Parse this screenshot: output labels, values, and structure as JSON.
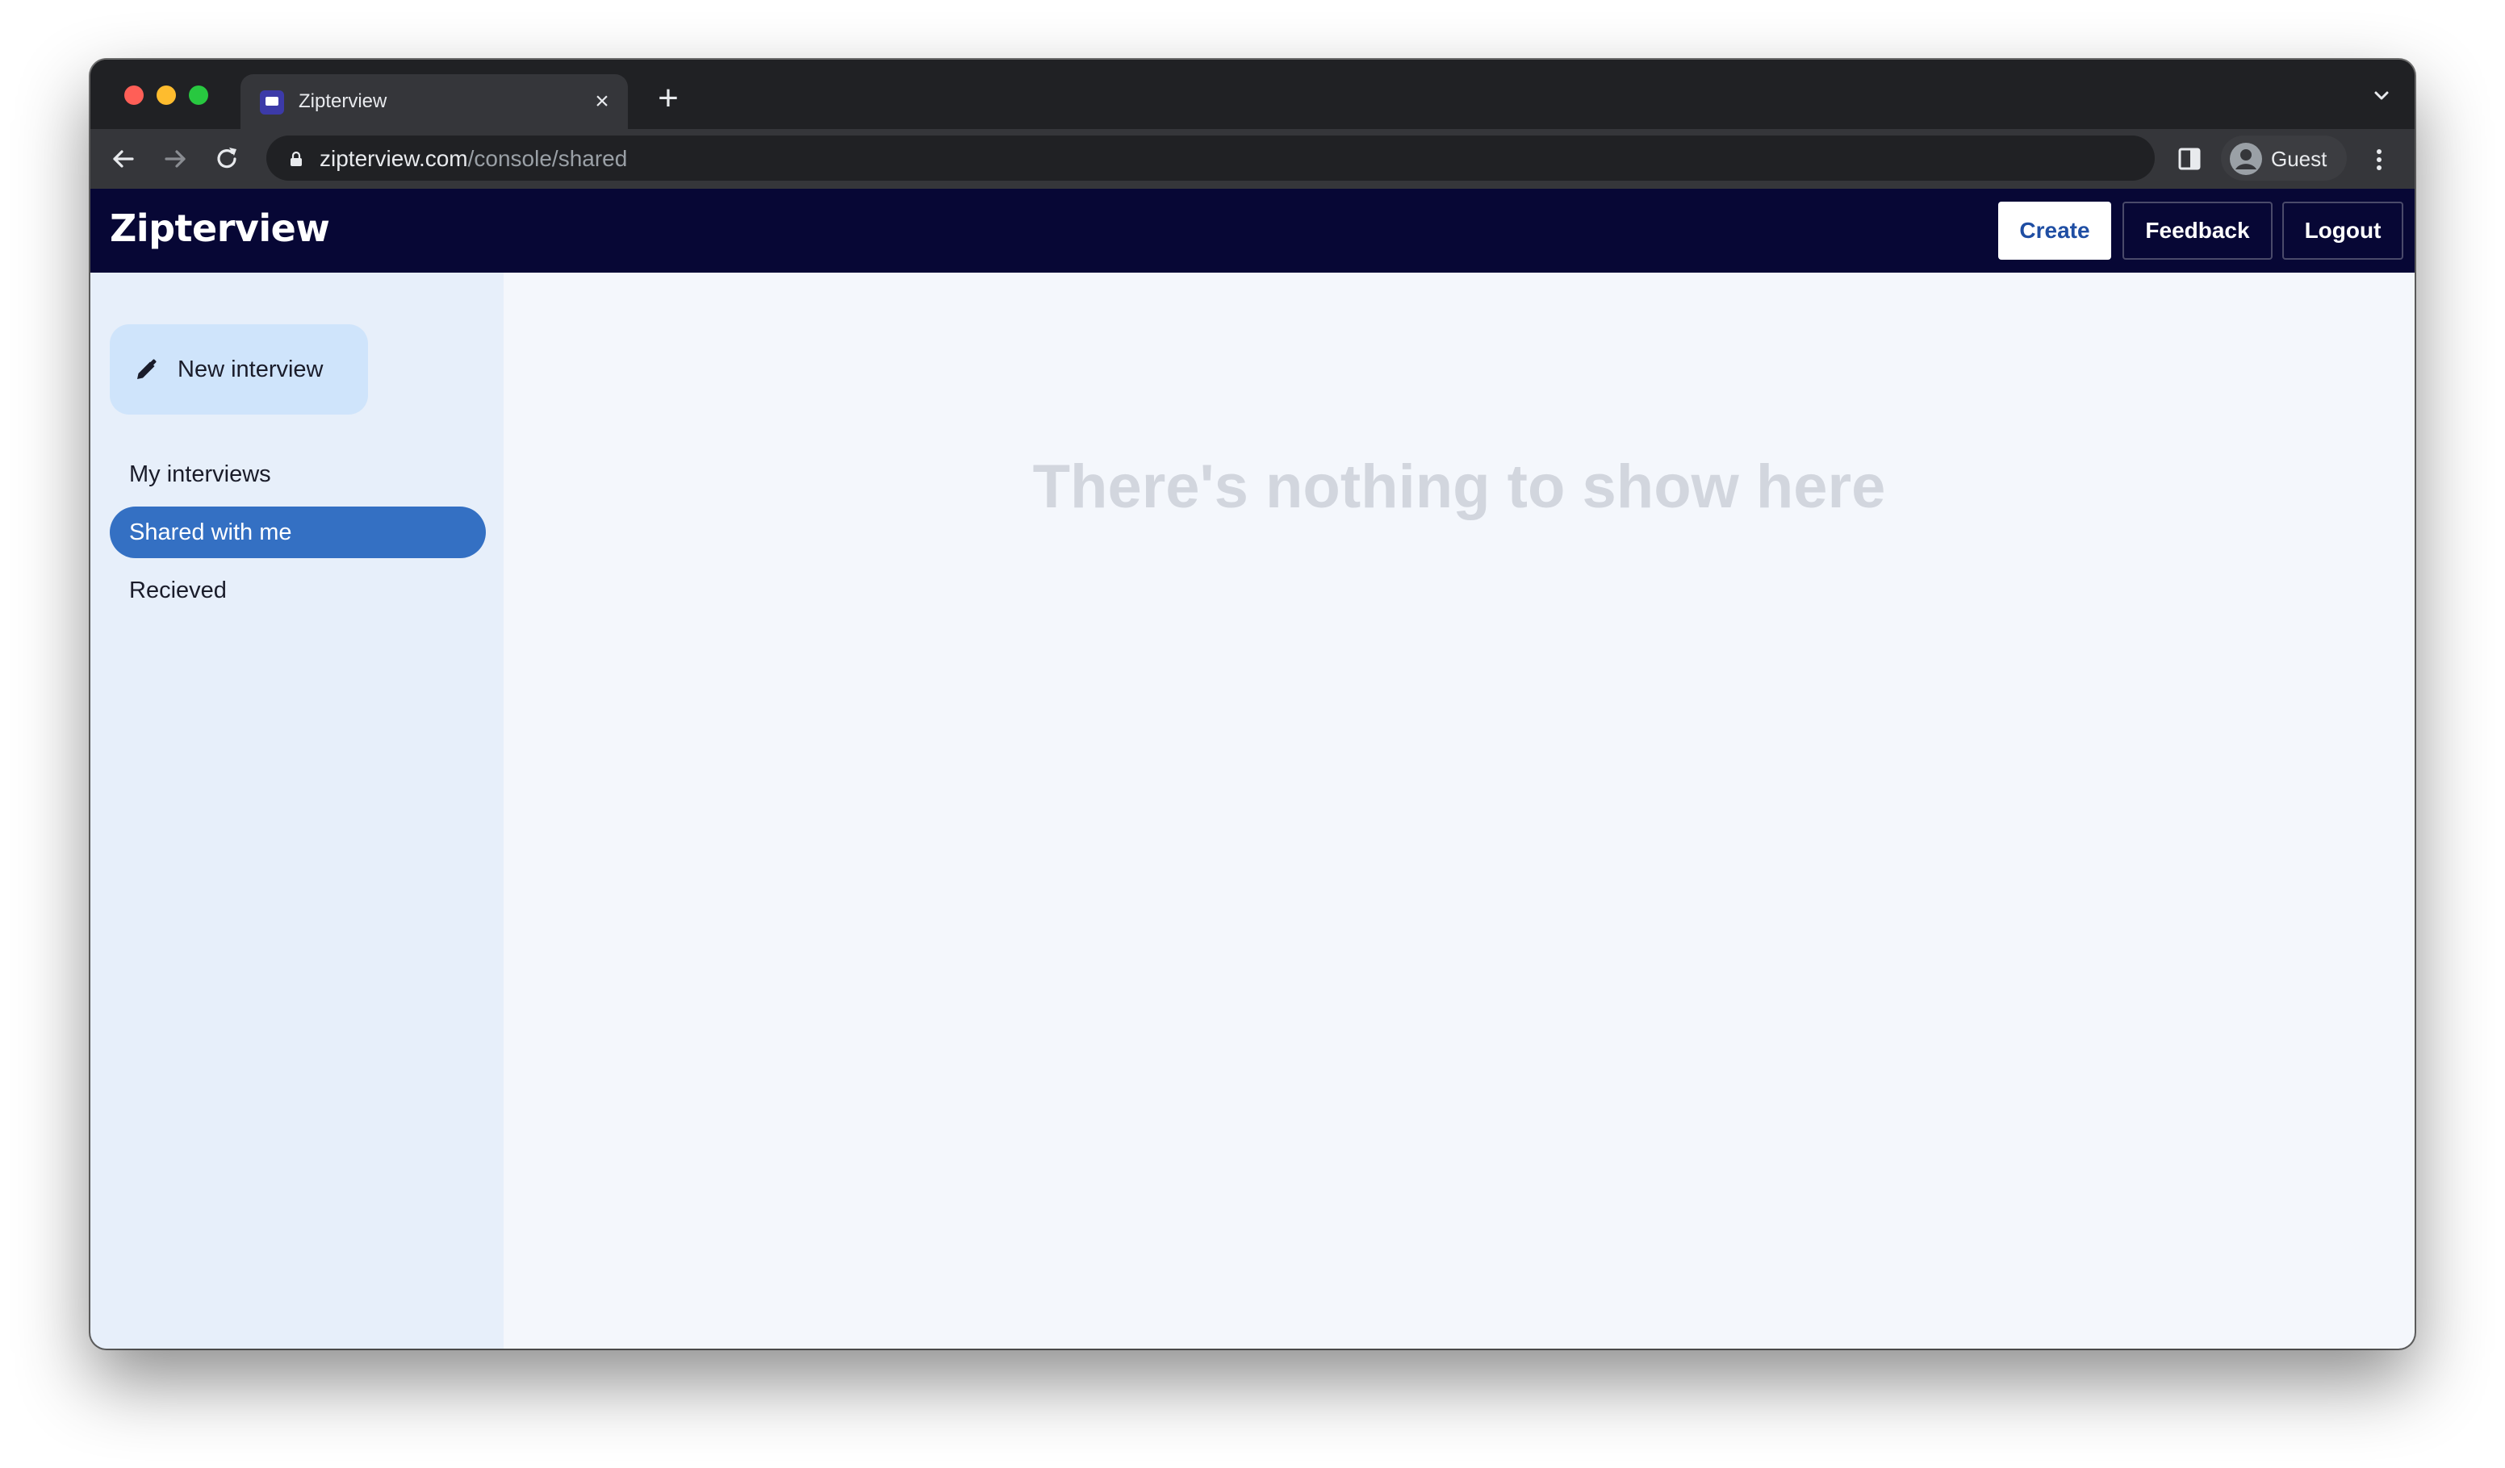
{
  "browser": {
    "tab_title": "Zipterview",
    "url_host": "zipterview.com",
    "url_path": "/console/shared",
    "profile_label": "Guest",
    "icons": {
      "favicon": "zipterview-favicon-icon",
      "close_tab": "close-icon",
      "new_tab": "plus-icon",
      "back": "arrow-left-icon",
      "forward": "arrow-right-icon",
      "reload": "reload-icon",
      "lock": "lock-icon",
      "side_panel": "side-panel-icon",
      "profile": "person-icon",
      "menu": "kebab-menu-icon",
      "tab_search": "chevron-down-icon"
    }
  },
  "app": {
    "logo": "Zipterview",
    "header_buttons": {
      "create": "Create",
      "feedback": "Feedback",
      "logout": "Logout"
    },
    "colors": {
      "header_bg": "#070735",
      "sidebar_bg": "#e7effa",
      "active_nav": "#3470c3",
      "new_button_bg": "#cfe4fb",
      "main_bg": "#f4f7fc",
      "create_text": "#1f4ea3"
    }
  },
  "sidebar": {
    "new_interview_label": "New interview",
    "new_interview_icon": "pencil-icon",
    "items": [
      {
        "label": "My interviews",
        "active": false
      },
      {
        "label": "Shared with me",
        "active": true
      },
      {
        "label": "Recieved",
        "active": false
      }
    ]
  },
  "main": {
    "empty_message": "There's nothing to show here"
  }
}
